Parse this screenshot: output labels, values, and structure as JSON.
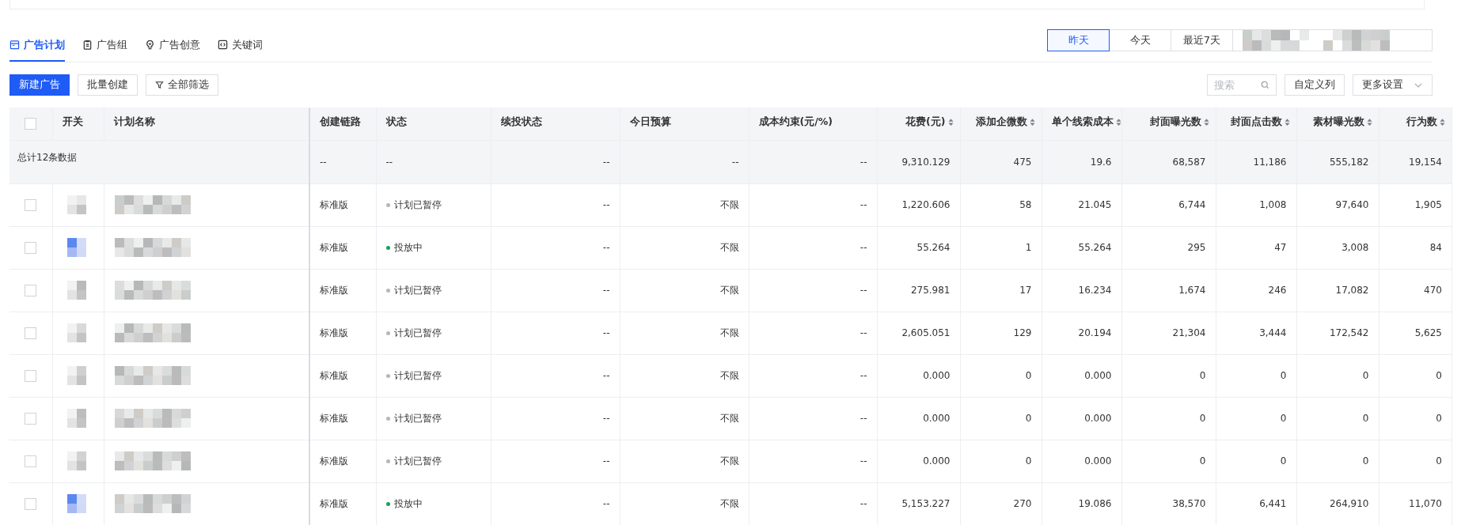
{
  "tabs": [
    {
      "label": "广告计划",
      "selected": true
    },
    {
      "label": "广告组",
      "selected": false
    },
    {
      "label": "广告创意",
      "selected": false
    },
    {
      "label": "关键词",
      "selected": false
    }
  ],
  "date_ranges": [
    {
      "label": "昨天",
      "selected": true
    },
    {
      "label": "今天",
      "selected": false
    },
    {
      "label": "最近7天",
      "selected": false
    }
  ],
  "toolbar": {
    "buttons": [
      {
        "label": "新建广告",
        "kind": "primary"
      },
      {
        "label": "批量创建",
        "kind": "plain"
      },
      {
        "label": "全部筛选",
        "kind": "filter"
      }
    ],
    "search": {
      "placeholder": "搜索"
    },
    "right_buttons": [
      {
        "label": "自定义列",
        "kind": "plain"
      },
      {
        "label": "更多设置",
        "kind": "dropdown"
      }
    ]
  },
  "table": {
    "header_checked": false,
    "columns": [
      {
        "label": "开关",
        "sortable": false
      },
      {
        "label": "计划名称",
        "sortable": false
      },
      {
        "label": "创建链路",
        "sortable": false
      },
      {
        "label": "状态",
        "sortable": false
      },
      {
        "label": "续投状态",
        "sortable": false
      },
      {
        "label": "今日预算",
        "sortable": false
      },
      {
        "label": "成本约束(元/%)",
        "sortable": false
      },
      {
        "label": "花费(元)",
        "sortable": true
      },
      {
        "label": "添加企微数",
        "sortable": true
      },
      {
        "label": "单个线索成本",
        "sortable": true
      },
      {
        "label": "封面曝光数",
        "sortable": true
      },
      {
        "label": "封面点击数",
        "sortable": true
      },
      {
        "label": "素材曝光数",
        "sortable": true
      },
      {
        "label": "行为数",
        "sortable": true
      }
    ],
    "summary": {
      "label": "总计12条数据",
      "chain": "--",
      "status": "--",
      "renew": "--",
      "budget": "--",
      "cost_limit": "--",
      "values": [
        "9,310.129",
        "475",
        "19.6",
        "68,587",
        "11,186",
        "555,182",
        "19,154"
      ]
    },
    "rows": [
      {
        "checked": false,
        "switch_on": false,
        "chain": "标准版",
        "status": {
          "label": "计划已暂停",
          "color": "#b4b7bd"
        },
        "renew": "--",
        "budget": "不限",
        "cost_limit": "--",
        "values": [
          "1,220.606",
          "58",
          "21.045",
          "6,744",
          "1,008",
          "97,640",
          "1,905"
        ]
      },
      {
        "checked": false,
        "switch_on": true,
        "chain": "标准版",
        "status": {
          "label": "投放中",
          "color": "#17a05d"
        },
        "renew": "--",
        "budget": "不限",
        "cost_limit": "--",
        "values": [
          "55.264",
          "1",
          "55.264",
          "295",
          "47",
          "3,008",
          "84"
        ]
      },
      {
        "checked": false,
        "switch_on": false,
        "chain": "标准版",
        "status": {
          "label": "计划已暂停",
          "color": "#b4b7bd"
        },
        "renew": "--",
        "budget": "不限",
        "cost_limit": "--",
        "values": [
          "275.981",
          "17",
          "16.234",
          "1,674",
          "246",
          "17,082",
          "470"
        ]
      },
      {
        "checked": false,
        "switch_on": false,
        "chain": "标准版",
        "status": {
          "label": "计划已暂停",
          "color": "#b4b7bd"
        },
        "renew": "--",
        "budget": "不限",
        "cost_limit": "--",
        "values": [
          "2,605.051",
          "129",
          "20.194",
          "21,304",
          "3,444",
          "172,542",
          "5,625"
        ]
      },
      {
        "checked": false,
        "switch_on": false,
        "chain": "标准版",
        "status": {
          "label": "计划已暂停",
          "color": "#b4b7bd"
        },
        "renew": "--",
        "budget": "不限",
        "cost_limit": "--",
        "values": [
          "0.000",
          "0",
          "0.000",
          "0",
          "0",
          "0",
          "0"
        ]
      },
      {
        "checked": false,
        "switch_on": false,
        "chain": "标准版",
        "status": {
          "label": "计划已暂停",
          "color": "#b4b7bd"
        },
        "renew": "--",
        "budget": "不限",
        "cost_limit": "--",
        "values": [
          "0.000",
          "0",
          "0.000",
          "0",
          "0",
          "0",
          "0"
        ]
      },
      {
        "checked": false,
        "switch_on": false,
        "chain": "标准版",
        "status": {
          "label": "计划已暂停",
          "color": "#b4b7bd"
        },
        "renew": "--",
        "budget": "不限",
        "cost_limit": "--",
        "values": [
          "0.000",
          "0",
          "0.000",
          "0",
          "0",
          "0",
          "0"
        ]
      },
      {
        "checked": false,
        "switch_on": true,
        "chain": "标准版",
        "status": {
          "label": "投放中",
          "color": "#17a05d"
        },
        "renew": "--",
        "budget": "不限",
        "cost_limit": "--",
        "values": [
          "5,153.227",
          "270",
          "19.086",
          "38,570",
          "6,441",
          "264,910",
          "11,070"
        ]
      }
    ]
  }
}
